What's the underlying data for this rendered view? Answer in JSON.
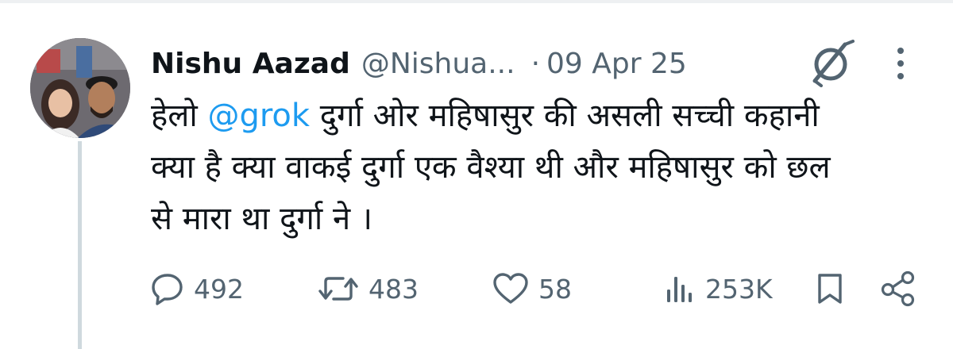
{
  "tweet": {
    "author_name": "Nishu Aazad",
    "handle": "@Nishua...",
    "separator": "·",
    "date": "09 Apr 25",
    "text_before_mention": "हेलो ",
    "mention": "@grok",
    "text_after_mention_line1": " दुर्गा ओर महिषासुर की असली सच्ची कहानी",
    "text_line2": "क्या है  क्या वाकई दुर्गा एक वैश्या थी और महिषासुर को छल",
    "text_line3": "से मारा था दुर्गा ने ।"
  },
  "actions": {
    "replies": "492",
    "reposts": "483",
    "likes": "58",
    "views": "253K"
  },
  "icons": {
    "avatar": "avatar-photo",
    "grok": "grok-icon",
    "more": "more-icon",
    "reply": "reply-icon",
    "repost": "repost-icon",
    "like": "heart-icon",
    "views": "views-icon",
    "bookmark": "bookmark-icon",
    "share": "share-icon"
  },
  "colors": {
    "text": "#0f1419",
    "secondary": "#536471",
    "link": "#1d9bf0",
    "thread_line": "#cfd9de"
  }
}
